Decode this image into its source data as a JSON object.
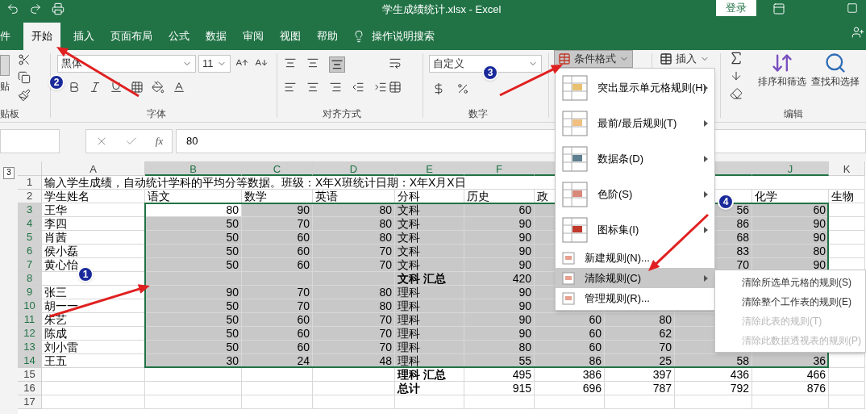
{
  "title_bar": {
    "title": "学生成绩统计.xlsx  -  Excel",
    "sign_in": "登录"
  },
  "tabs": [
    {
      "label": "件",
      "selected": false
    },
    {
      "label": "开始",
      "selected": true
    },
    {
      "label": "插入",
      "selected": false
    },
    {
      "label": "页面布局",
      "selected": false
    },
    {
      "label": "公式",
      "selected": false
    },
    {
      "label": "数据",
      "selected": false
    },
    {
      "label": "审阅",
      "selected": false
    },
    {
      "label": "视图",
      "selected": false
    },
    {
      "label": "帮助",
      "selected": false
    }
  ],
  "tell_me": "操作说明搜索",
  "ribbon": {
    "clipboard": {
      "paste": "贴",
      "label": "贴板"
    },
    "font": {
      "name": "黑体",
      "size": "11",
      "label": "字体"
    },
    "alignment": {
      "label": "对齐方式"
    },
    "number": {
      "format": "自定义",
      "label": "数字"
    },
    "styles": {
      "conditional_format": "条件格式",
      "menu_open": true
    },
    "cells": {
      "insert": "插入"
    },
    "editing": {
      "sort": "排序和筛选",
      "find": "查找和选择",
      "label": "编辑"
    }
  },
  "formula_bar": {
    "function_label": "fx",
    "value": "80"
  },
  "outline_levels": [
    "3"
  ],
  "columns": [
    {
      "letter": "A",
      "selected": false,
      "kind": "text"
    },
    {
      "letter": "B",
      "selected": true,
      "kind": "number"
    },
    {
      "letter": "C",
      "selected": true,
      "kind": "number"
    },
    {
      "letter": "D",
      "selected": true,
      "kind": "number"
    },
    {
      "letter": "E",
      "selected": true,
      "kind": "text"
    },
    {
      "letter": "F",
      "selected": true,
      "kind": "number"
    },
    {
      "selected": true,
      "kind": "number"
    },
    {
      "selected": true,
      "kind": "number"
    },
    {
      "selected": true,
      "kind": "number"
    },
    {
      "letter": "J",
      "selected": true,
      "kind": "number"
    },
    {
      "letter": "K",
      "selected": false,
      "kind": "text"
    }
  ],
  "rows": [
    {
      "number": "1",
      "selected": false,
      "cells": {
        "A": "输入学生成绩，自动统计学科的平均分等数据。班级：X年X班统计日期：X年X月X日"
      }
    },
    {
      "number": "2",
      "selected": false,
      "kind": "header",
      "cells": {
        "A": "学生姓名",
        "B": "语文",
        "C": "数学",
        "D": "英语",
        "E": "分科",
        "F": "历史",
        "G": "政",
        "J": "化学",
        "K": "生物"
      }
    },
    {
      "number": "3",
      "selected": true,
      "cells": {
        "A": "王华",
        "B": "80",
        "C": "90",
        "D": "80",
        "E": "文科",
        "F": "60",
        "I": "56",
        "J": "60"
      }
    },
    {
      "number": "4",
      "selected": true,
      "cells": {
        "A": "李四",
        "B": "50",
        "C": "70",
        "D": "80",
        "E": "文科",
        "F": "90",
        "I": "86",
        "J": "90"
      }
    },
    {
      "number": "5",
      "selected": true,
      "cells": {
        "A": "肖茜",
        "B": "50",
        "C": "60",
        "D": "80",
        "E": "文科",
        "F": "90",
        "I": "68",
        "J": "90"
      }
    },
    {
      "number": "6",
      "selected": true,
      "cells": {
        "A": "侯小磊",
        "B": "50",
        "C": "60",
        "D": "70",
        "E": "文科",
        "F": "90",
        "I": "83",
        "J": "80"
      }
    },
    {
      "number": "7",
      "selected": true,
      "cells": {
        "A": "黄心怡",
        "B": "50",
        "C": "60",
        "D": "70",
        "E": "文科",
        "F": "90",
        "I": "70",
        "J": "90"
      }
    },
    {
      "number": "8",
      "selected": true,
      "cells": {
        "E": {
          "text": "文科 汇总",
          "bold": true
        },
        "F": "420"
      }
    },
    {
      "number": "9",
      "selected": true,
      "cells": {
        "A": "张三",
        "B": "90",
        "C": "70",
        "D": "80",
        "E": "理科",
        "F": "90"
      }
    },
    {
      "number": "10",
      "selected": true,
      "cells": {
        "A": "胡一一",
        "B": "50",
        "C": "70",
        "D": "80",
        "E": "理科",
        "F": "90"
      }
    },
    {
      "number": "11",
      "selected": true,
      "cells": {
        "A": "朱艺",
        "B": "50",
        "C": "60",
        "D": "70",
        "E": "理科",
        "F": "90",
        "G": "60",
        "H": "80"
      }
    },
    {
      "number": "12",
      "selected": true,
      "cells": {
        "A": "陈成",
        "B": "50",
        "C": "60",
        "D": "70",
        "E": "理科",
        "F": "90",
        "G": "60",
        "H": "62"
      }
    },
    {
      "number": "13",
      "selected": true,
      "cells": {
        "A": "刘小雷",
        "B": "50",
        "C": "60",
        "D": "70",
        "E": "理科",
        "F": "80",
        "G": "60",
        "H": "70"
      }
    },
    {
      "number": "14",
      "selected": true,
      "cells": {
        "A": "王五",
        "B": "30",
        "C": "24",
        "D": "48",
        "E": "理科",
        "F": "55",
        "G": "86",
        "H": "25",
        "I": "58",
        "J": "36"
      }
    },
    {
      "number": "15",
      "selected": false,
      "cells": {
        "E": {
          "text": "理科 汇总",
          "bold": true
        },
        "F": "495",
        "G": "386",
        "H": "397",
        "I": "436",
        "J": "466"
      }
    },
    {
      "number": "16",
      "selected": false,
      "cells": {
        "E": {
          "text": "总计",
          "bold": true
        },
        "F": "915",
        "G": "696",
        "H": "787",
        "I": "792",
        "J": "876"
      }
    },
    {
      "number": "17",
      "selected": false,
      "cells": {}
    }
  ],
  "menu": {
    "items": [
      {
        "label": "突出显示单元格规则(H)",
        "kind": "large",
        "selected": false
      },
      {
        "label": "最前/最后规则(T)",
        "kind": "large",
        "selected": false
      },
      {
        "label": "数据条(D)",
        "kind": "large",
        "selected": false
      },
      {
        "label": "色阶(S)",
        "kind": "large",
        "selected": false
      },
      {
        "label": "图标集(I)",
        "kind": "large",
        "selected": false
      },
      {
        "label": "新建规则(N)...",
        "kind": "small",
        "selected": false
      },
      {
        "label": "清除规则(C)",
        "kind": "submenu",
        "selected": true
      },
      {
        "label": "管理规则(R)...",
        "kind": "small",
        "selected": false
      }
    ]
  },
  "submenu": {
    "items": [
      {
        "label": "清除所选单元格的规则(S)",
        "disabled": false
      },
      {
        "label": "清除整个工作表的规则(E)",
        "disabled": false
      },
      {
        "label": "清除此表的规则(T)",
        "disabled": true
      },
      {
        "label": "清除此数据透视表的规则(P)",
        "disabled": true
      }
    ]
  },
  "annotations": [
    {
      "number": "1"
    },
    {
      "number": "2"
    },
    {
      "number": "3"
    },
    {
      "number": "4"
    }
  ]
}
